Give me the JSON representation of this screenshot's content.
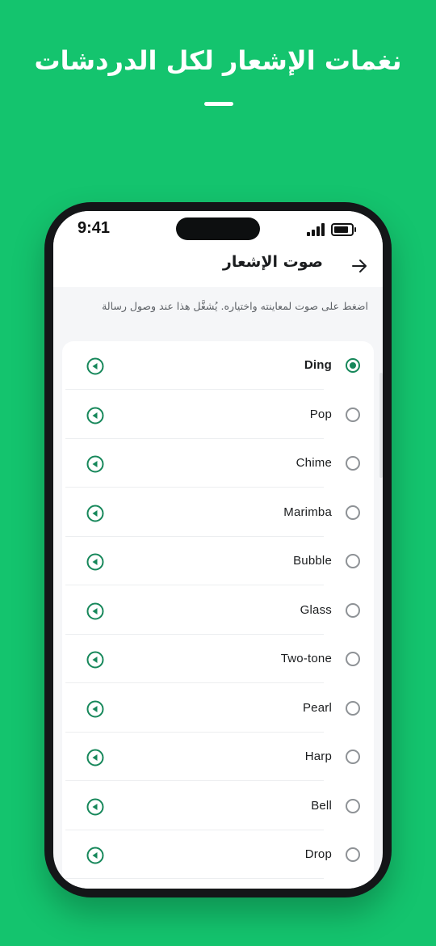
{
  "promo": {
    "headline": "نغمات الإشعار لكل الدردشات"
  },
  "status_bar": {
    "time": "9:41",
    "icons": [
      "signal-icon",
      "battery-icon"
    ]
  },
  "app_bar": {
    "title": "صوت الإشعار",
    "back_icon": "arrow-right-icon"
  },
  "hint": "اضغط على صوت لمعاينته واختياره. يُشغَّل هذا عند وصول رسالة",
  "sounds": [
    {
      "label": "Ding",
      "selected": true
    },
    {
      "label": "Pop",
      "selected": false
    },
    {
      "label": "Chime",
      "selected": false
    },
    {
      "label": "Marimba",
      "selected": false
    },
    {
      "label": "Bubble",
      "selected": false
    },
    {
      "label": "Glass",
      "selected": false
    },
    {
      "label": "Two-tone",
      "selected": false
    },
    {
      "label": "Pearl",
      "selected": false
    },
    {
      "label": "Harp",
      "selected": false
    },
    {
      "label": "Bell",
      "selected": false
    },
    {
      "label": "Drop",
      "selected": false
    }
  ],
  "colors": {
    "background": "#14c46e",
    "accent": "#16875a",
    "phone_frame": "#141618"
  }
}
